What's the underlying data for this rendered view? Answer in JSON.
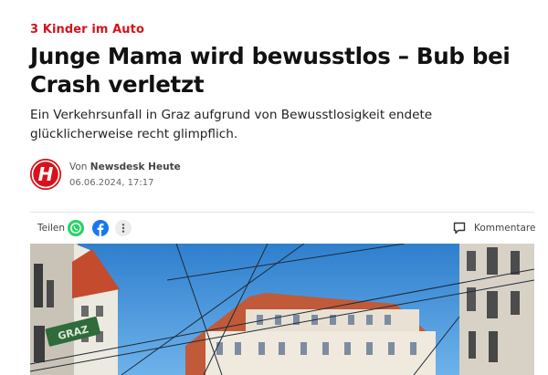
{
  "article": {
    "kicker": "3 Kinder im Auto",
    "headline": "Junge Mama wird bewusstlos – Bub bei Crash verletzt",
    "lead": "Ein Verkehrsunfall in Graz aufgrund von Bewusstlosigkeit endete glücklicherweise recht glimpflich."
  },
  "author": {
    "prefix": "Von",
    "name": "Newsdesk Heute",
    "date": "06.06.2024, 17:17",
    "logo_letter": "H"
  },
  "share": {
    "label": "Teilen",
    "icons": [
      "whatsapp-icon",
      "facebook-icon",
      "more-options-icon"
    ],
    "comments_label": "Kommentare"
  },
  "hero": {
    "sign_text": "GRAZ"
  },
  "colors": {
    "brand": "#d7121b",
    "whatsapp": "#25d366",
    "facebook": "#1877f2",
    "sky": "#3d8fd8"
  }
}
